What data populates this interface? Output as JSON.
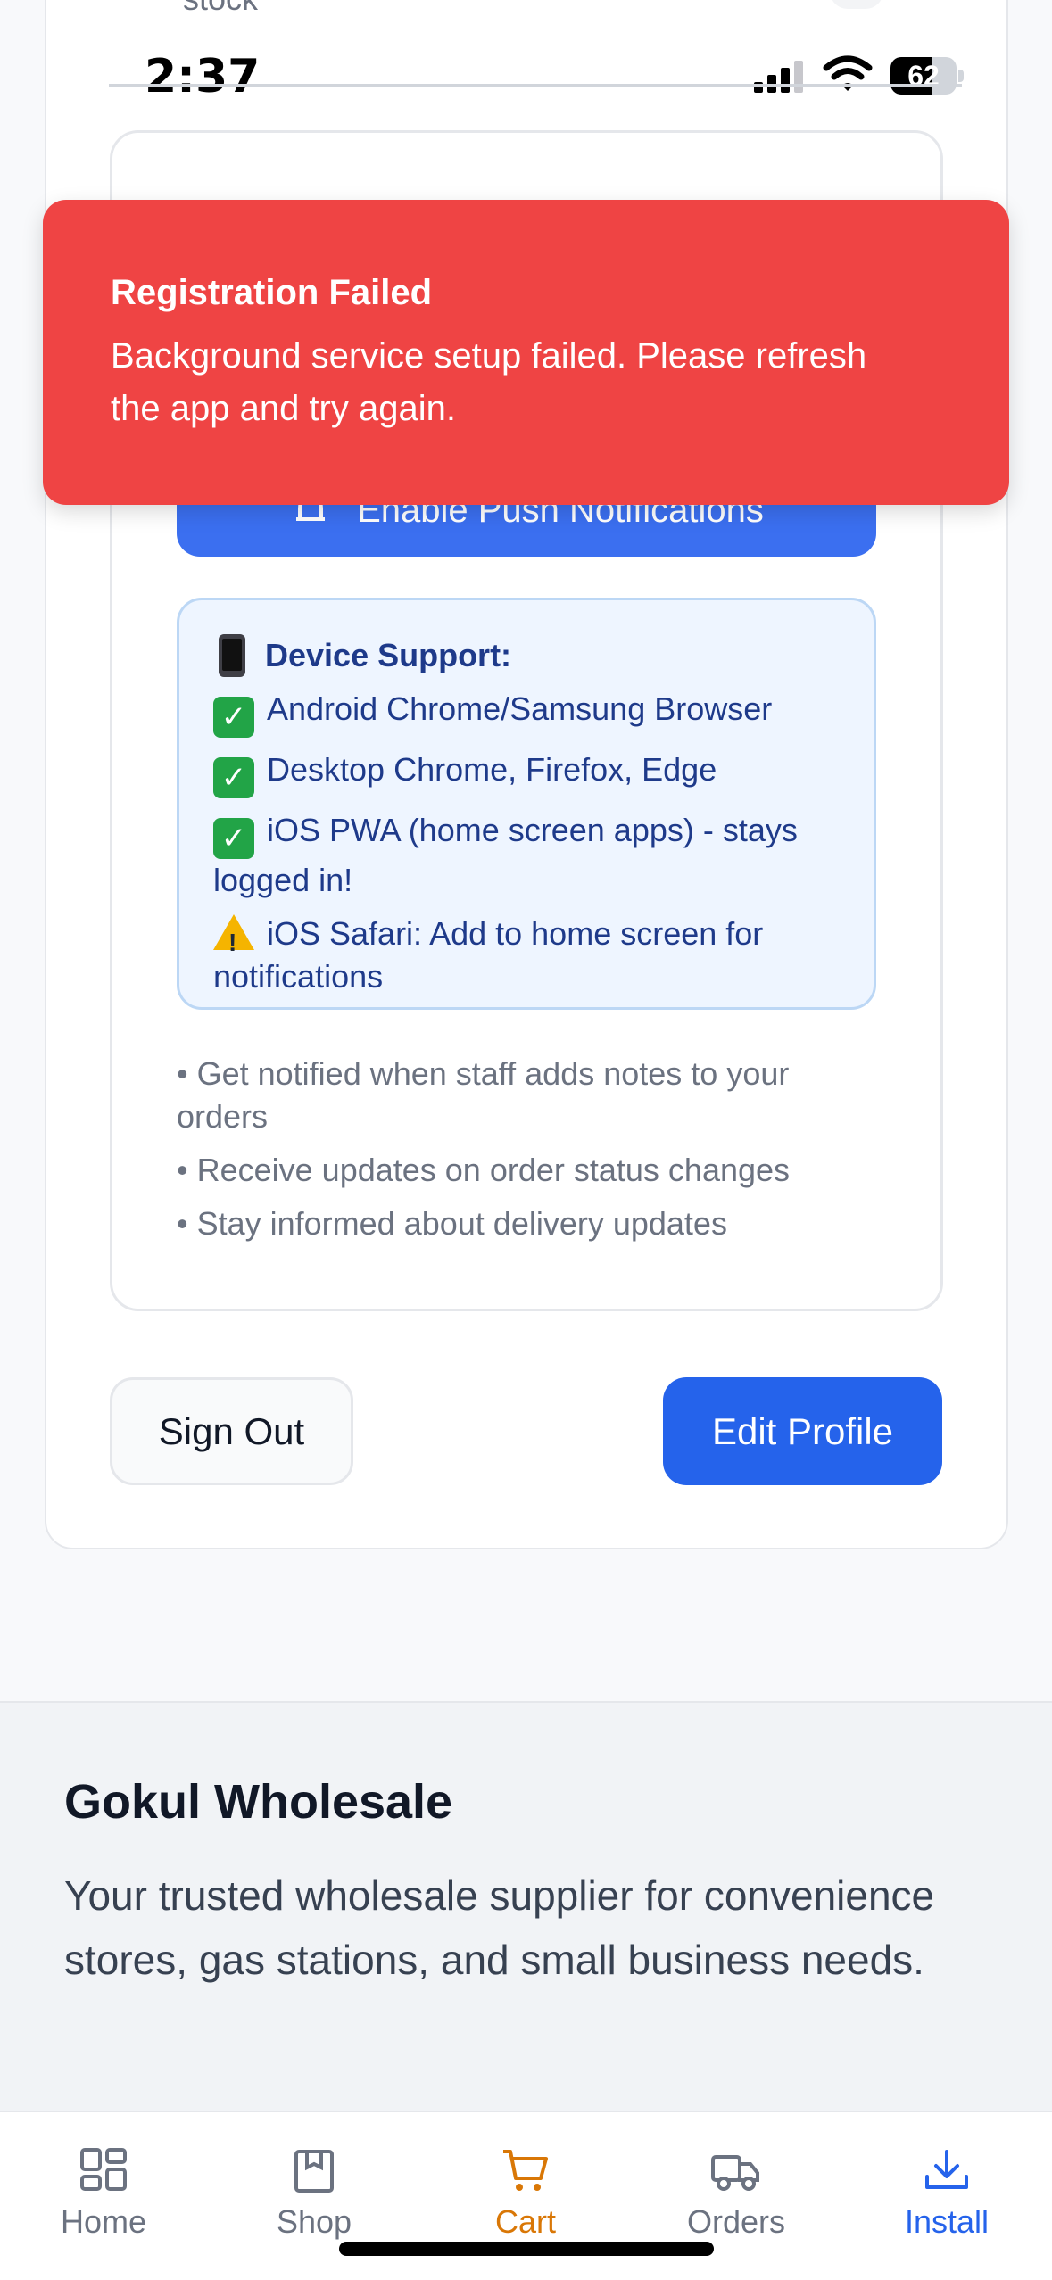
{
  "status_bar": {
    "time": "2:37",
    "battery": "62",
    "battery_level": 0.62
  },
  "clipped_text": "stock",
  "toast": {
    "title": "Registration Failed",
    "message": "Background service setup failed. Please refresh the app and try again.",
    "color": "#ef4444"
  },
  "notifications": {
    "enable_button_label": "Enable Push Notifications",
    "support_title": "Device Support:",
    "support_items": [
      "Android Chrome/Samsung Browser",
      "Desktop Chrome, Firefox, Edge",
      "iOS PWA (home screen apps) - stays logged in!",
      "iOS Safari: Add to home screen for notifications"
    ],
    "benefits": [
      "• Get notified when staff adds notes to your orders",
      "• Receive updates on order status changes",
      "• Stay informed about delivery updates"
    ]
  },
  "actions": {
    "sign_out": "Sign Out",
    "edit_profile": "Edit Profile"
  },
  "footer": {
    "title": "Gokul Wholesale",
    "description": "Your trusted wholesale supplier for convenience stores, gas stations, and small business needs."
  },
  "nav": {
    "items": [
      {
        "label": "Home",
        "icon": "grid-icon"
      },
      {
        "label": "Shop",
        "icon": "package-icon"
      },
      {
        "label": "Cart",
        "icon": "cart-icon"
      },
      {
        "label": "Orders",
        "icon": "truck-icon"
      },
      {
        "label": "Install",
        "icon": "download-icon"
      }
    ],
    "active_color": "#d97706",
    "install_color": "#2563eb"
  }
}
